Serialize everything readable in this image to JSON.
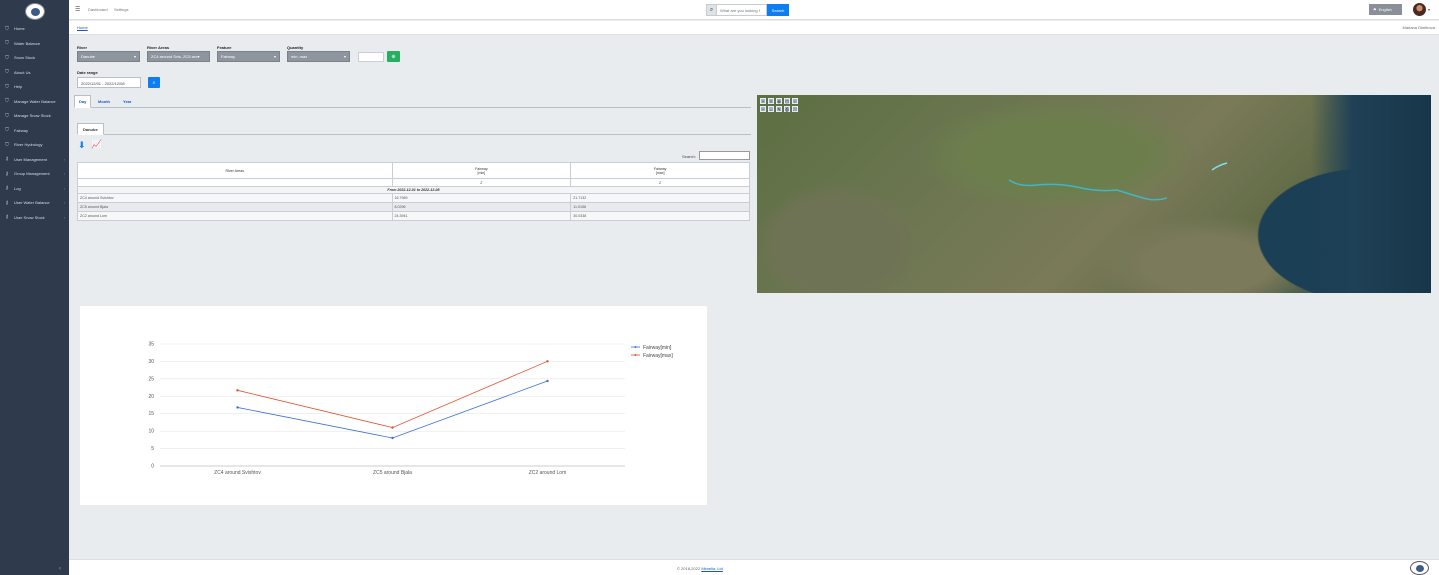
{
  "sidebar": {
    "items": [
      {
        "label": "Home",
        "icon": "shield-icon"
      },
      {
        "label": "Water Balance",
        "icon": "shield-icon"
      },
      {
        "label": "Snow Stock",
        "icon": "shield-icon"
      },
      {
        "label": "About Us",
        "icon": "shield-icon"
      },
      {
        "label": "Help",
        "icon": "shield-icon"
      },
      {
        "label": "Manage Water Balance",
        "icon": "shield-icon"
      },
      {
        "label": "Manage Snow Stock",
        "icon": "shield-icon"
      },
      {
        "label": "Fairway",
        "icon": "shield-icon"
      },
      {
        "label": "River Hydrology",
        "icon": "shield-icon"
      },
      {
        "label": "User Management",
        "icon": "key-icon"
      },
      {
        "label": "Group Management",
        "icon": "key-icon"
      },
      {
        "label": "Log",
        "icon": "key-icon"
      },
      {
        "label": "User Water Balance",
        "icon": "key-icon"
      },
      {
        "label": "User Snow Stock",
        "icon": "key-icon"
      }
    ]
  },
  "topbar": {
    "links": [
      "Dashboard",
      "Settings"
    ],
    "search_placeholder": "What are you looking f",
    "search_button": "Search",
    "language": "English"
  },
  "breadcrumb": "Home",
  "user_name": "Mariana Dimitrova",
  "filters": {
    "river_label": "River",
    "river_value": "Danube",
    "areas_label": "River Areas",
    "areas_value": "ZC4 around Svis, ZC5 aro▾",
    "feature_label": "Feature",
    "feature_value": "Fairway",
    "quantity_label": "Quantity",
    "quantity_value": "min, max",
    "date_label": "Date range",
    "date_value": "2022/12/01 - 2022/12/08"
  },
  "tabs": [
    "Day",
    "Month",
    "Year"
  ],
  "subtab": "Danube",
  "table": {
    "search_label": "Search:",
    "headers": [
      "River Areas",
      "Fairway\n[min]",
      "Fairway\n[max]"
    ],
    "filter_row": [
      "",
      "Σ",
      "Σ"
    ],
    "date_row": "From 2022-12-01 to 2022-12-08",
    "rows": [
      [
        "ZC4 around Svishtov",
        "16.7989",
        "21.7132"
      ],
      [
        "ZC5 around Bjala",
        "8.0296",
        "11.0156"
      ],
      [
        "ZC2 around Lom",
        "24.3941",
        "30.0338"
      ]
    ]
  },
  "chart_data": {
    "type": "line",
    "categories": [
      "ZC4 around Svishtov",
      "ZC5 around Bjala",
      "ZC2 around Lom"
    ],
    "series": [
      {
        "name": "Fairway[min]",
        "values": [
          16.7989,
          8.0296,
          24.3941
        ],
        "color": "#3b6fd8"
      },
      {
        "name": "Fairway[max]",
        "values": [
          21.7132,
          11.0156,
          30.0338
        ],
        "color": "#e0522e"
      }
    ],
    "yticks": [
      0,
      5,
      10,
      15,
      20,
      25,
      30,
      35
    ],
    "ylim": [
      0,
      35
    ],
    "grid": true,
    "legend": "top-right"
  },
  "footer": {
    "copyright": "© 2018-2022",
    "company": "Mimelia, Ltd"
  }
}
